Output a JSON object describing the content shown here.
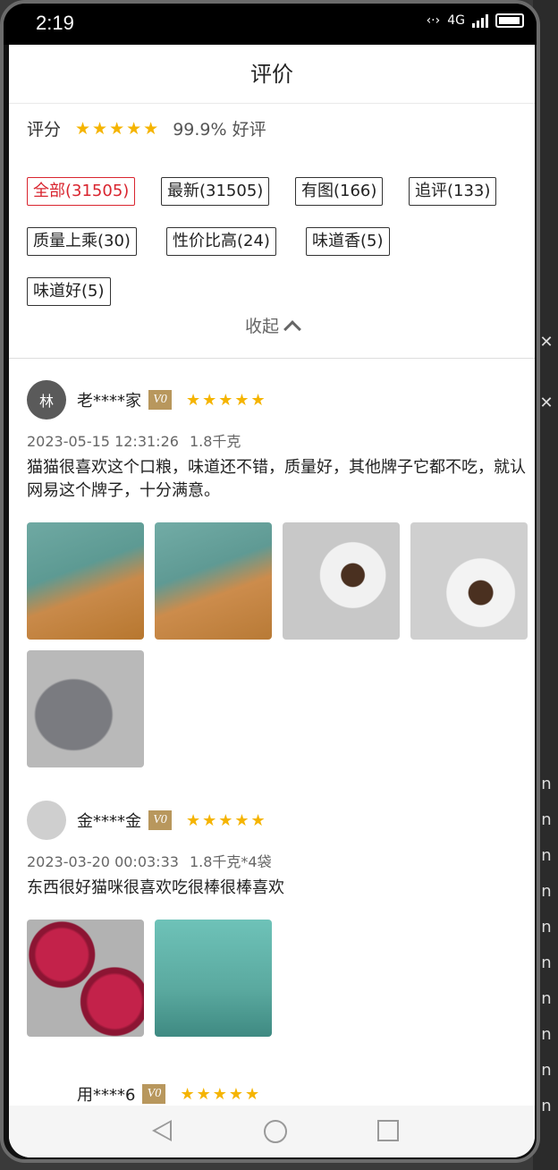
{
  "status": {
    "time": "2:19",
    "net": "4G"
  },
  "header": {
    "title": "评价"
  },
  "rating": {
    "label": "评分",
    "stars": "★★★★★",
    "good_rate": "99.9% 好评"
  },
  "tags": [
    {
      "label": "全部(31505)",
      "active": true
    },
    {
      "label": "最新(31505)",
      "active": false
    },
    {
      "label": "有图(166)",
      "active": false
    },
    {
      "label": "追评(133)",
      "active": false
    },
    {
      "label": "质量上乘(30)",
      "active": false
    },
    {
      "label": "性价比高(24)",
      "active": false
    },
    {
      "label": "味道香(5)",
      "active": false
    },
    {
      "label": "味道好(5)",
      "active": false
    }
  ],
  "collapse_label": "收起",
  "reviews": [
    {
      "user": "老****家",
      "avatar_char": "林",
      "level": "V0",
      "stars": "★★★★★",
      "date": "2023-05-15 12:31:26",
      "spec": "1.8千克",
      "content": "猫猫很喜欢这个口粮，味道还不错，质量好，其他牌子它都不吃，就认网易这个牌子，十分满意。",
      "images": [
        "cat-food-bag",
        "cat-food-bag",
        "cat-bowl",
        "cat-bowl",
        "cat-eating"
      ]
    },
    {
      "user": "金****金",
      "avatar_char": "",
      "level": "V0",
      "stars": "★★★★★",
      "date": "2023-03-20 00:03:33",
      "spec": "1.8千克*4袋",
      "content": "东西很好猫咪很喜欢吃很棒很棒喜欢",
      "images": [
        "cat-cans",
        "package-box"
      ]
    },
    {
      "user": "用****6",
      "level": "V0",
      "stars": "★★★★★"
    }
  ],
  "side": [
    "⁝",
    "X",
    "X",
    "n",
    "n",
    "n",
    "n",
    "n",
    "n",
    "n",
    "n",
    "n",
    "n",
    "1.96"
  ],
  "colors": {
    "accent_red": "#d9252f",
    "star": "#f5b400",
    "badge": "#b8975d"
  }
}
